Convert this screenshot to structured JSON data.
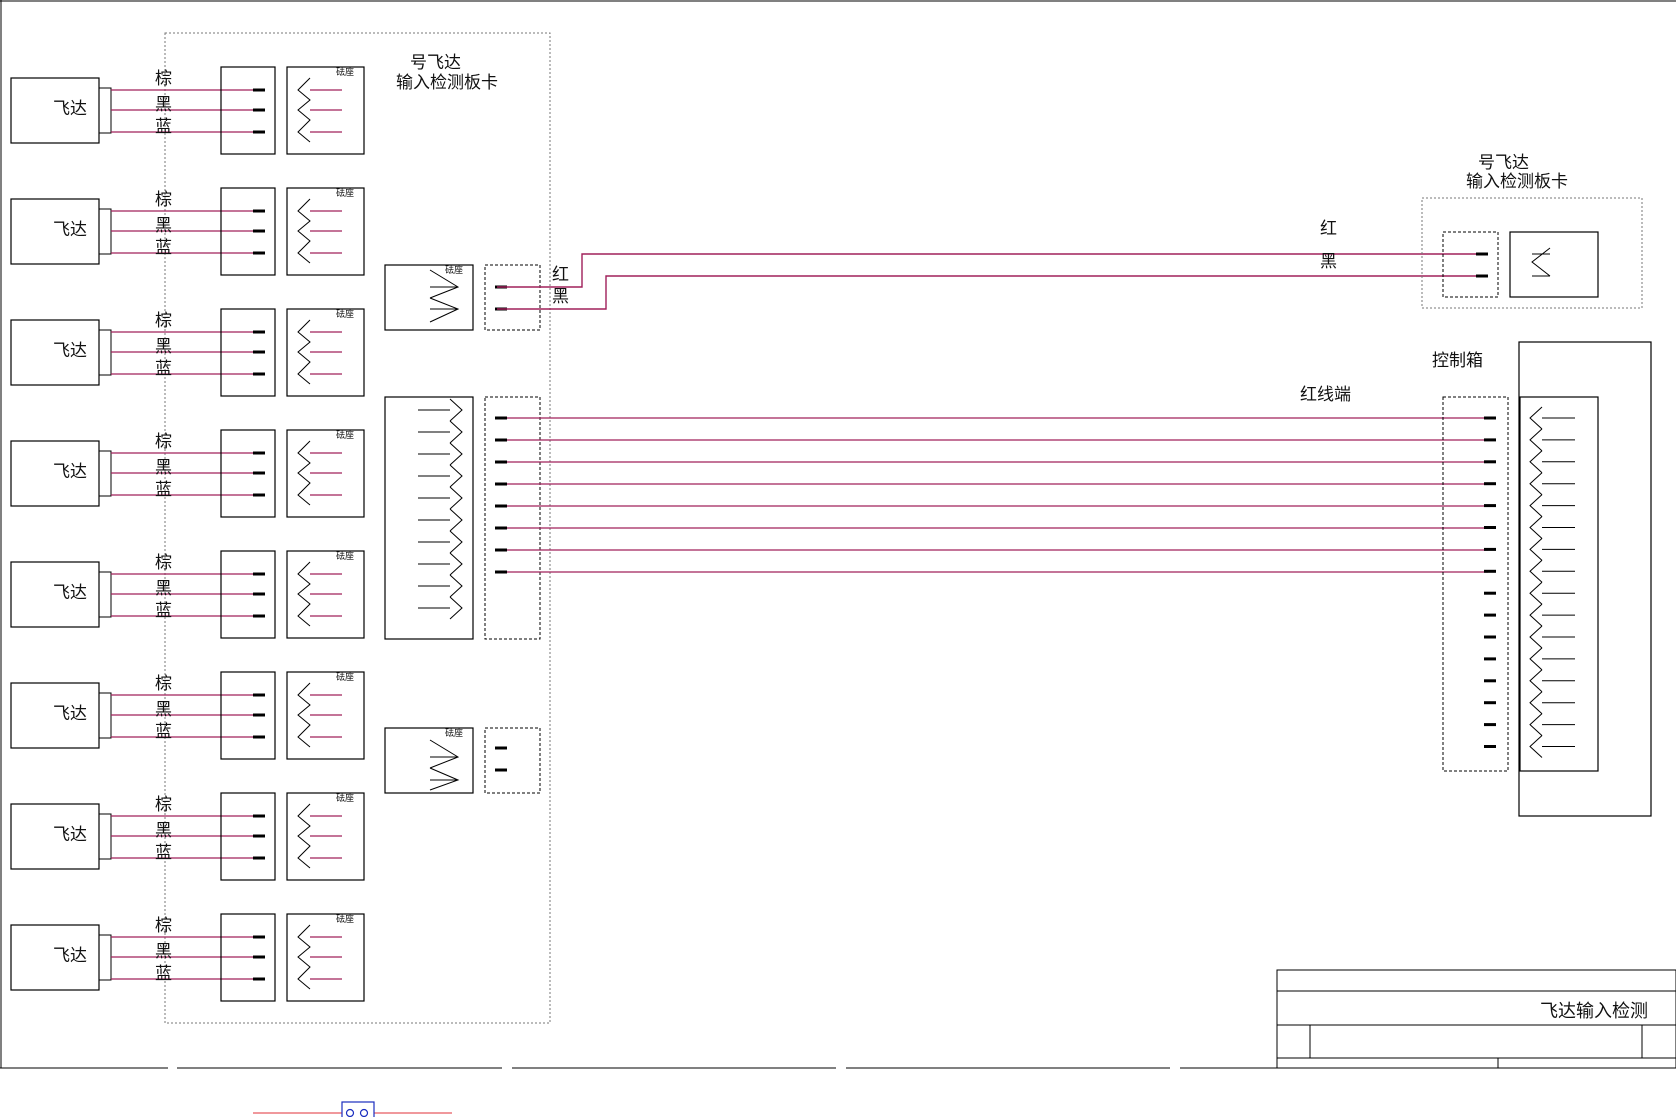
{
  "colors": {
    "wire": "#a0205a",
    "line": "#000000",
    "connector_blue": "#1a2dbf",
    "connector_red": "#e0303a"
  },
  "board_left": {
    "title_line1": "号飞达",
    "title_line2": "输入检测板卡"
  },
  "feeder": {
    "label": "飞达",
    "count": 8,
    "wire_labels": [
      "棕",
      "黑",
      "蓝"
    ]
  },
  "socket_small_label": "砝座",
  "power": {
    "left_red": "红",
    "left_black": "黑",
    "right_red": "红",
    "right_black": "黑"
  },
  "board_right": {
    "title_line1": "号飞达",
    "title_line2": "输入检测板卡"
  },
  "control_box": {
    "label": "控制箱",
    "red_end_label": "红线端",
    "pins": 16,
    "connected_wires": 8
  },
  "title_block": {
    "title": "飞达输入检测"
  }
}
